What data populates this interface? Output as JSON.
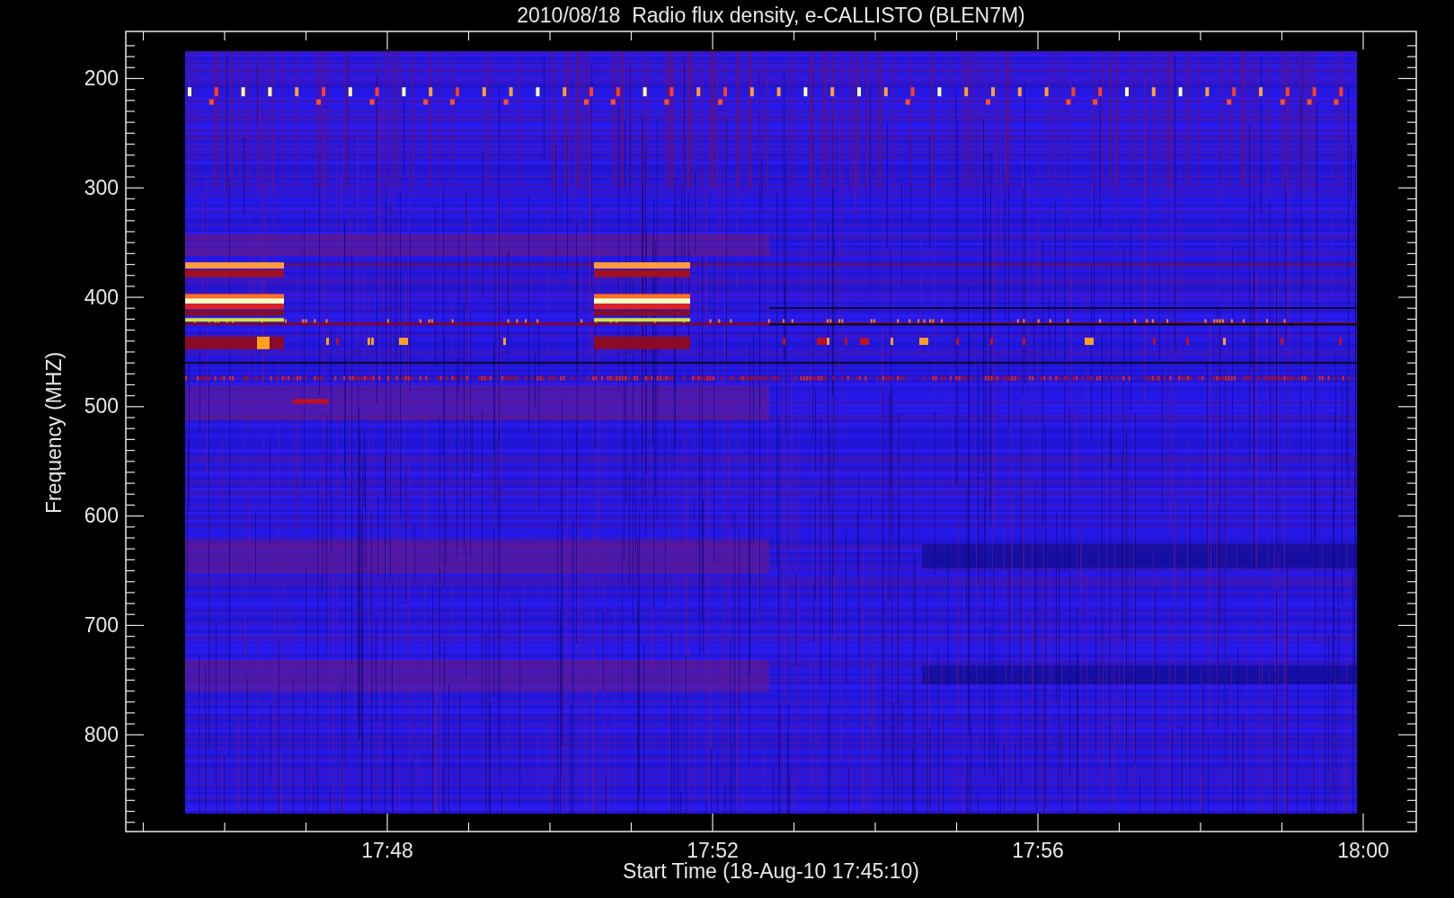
{
  "title": "2010/08/18  Radio flux density, e-CALLISTO (BLEN7M)",
  "y_axis": {
    "label": "Frequency (MHZ)",
    "ticks": [
      "200",
      "300",
      "400",
      "500",
      "600",
      "700",
      "800"
    ]
  },
  "x_axis": {
    "label": "Start Time (18-Aug-10 17:45:10)",
    "ticks": [
      "17:48",
      "17:52",
      "17:56",
      "18:00"
    ]
  }
}
